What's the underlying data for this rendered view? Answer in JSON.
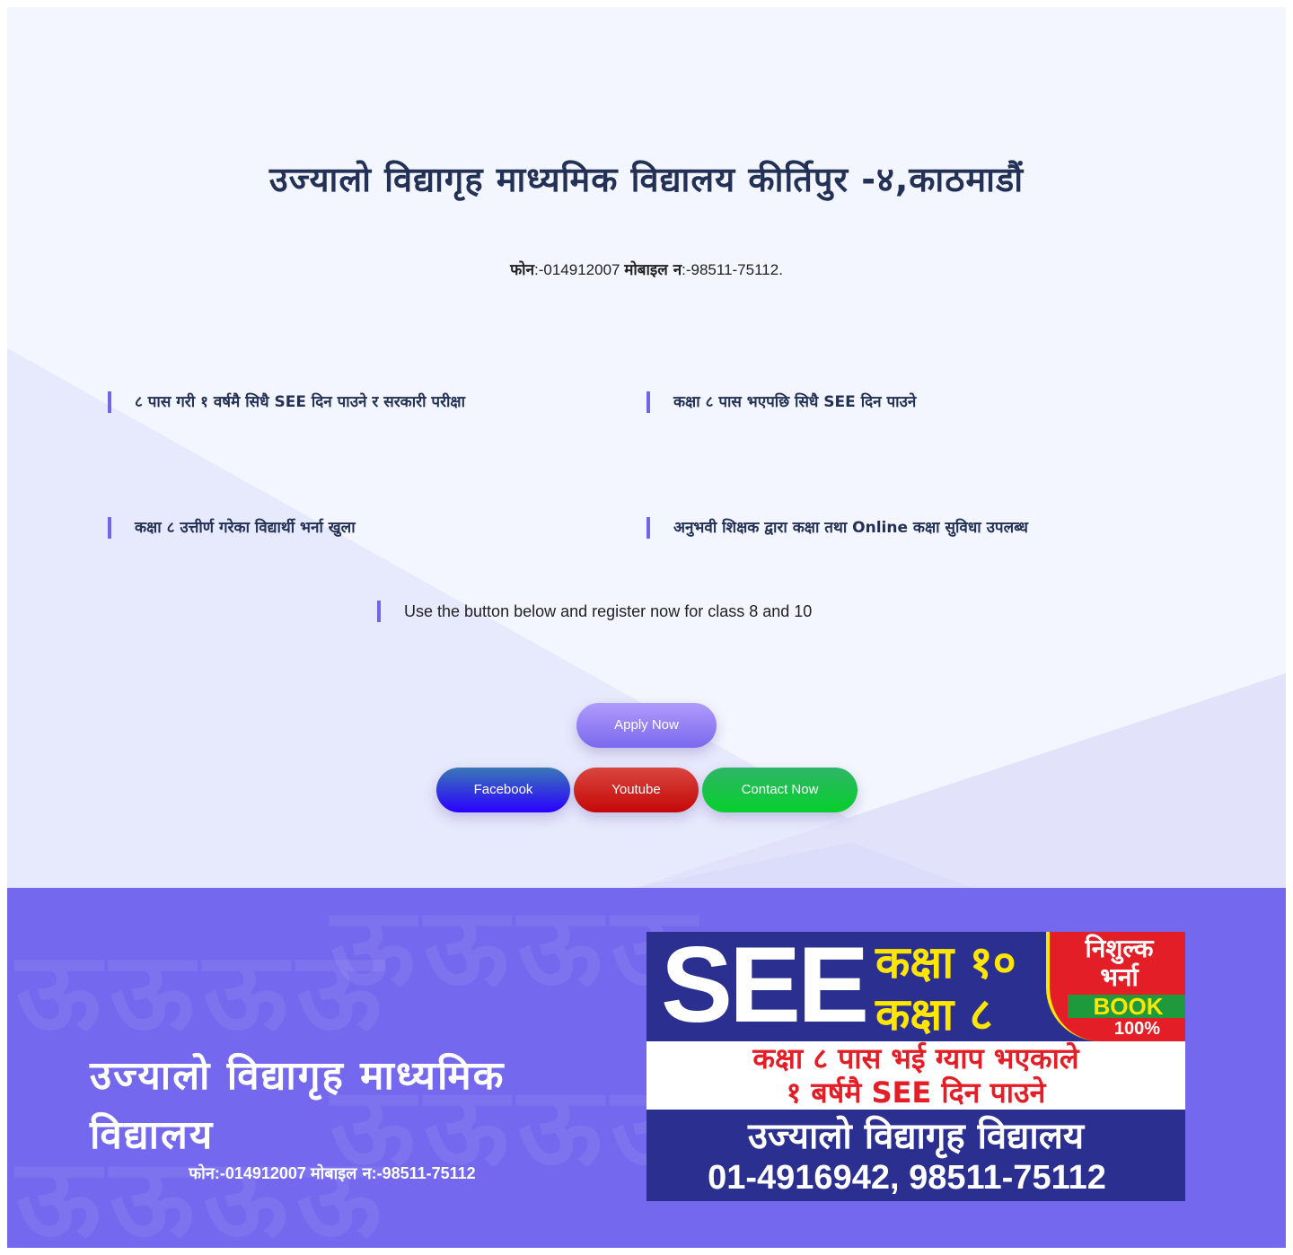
{
  "hero": {
    "title": "उज्यालो विद्यागृह माध्यमिक विद्यालय कीर्तिपुर -४,काठमाडौं",
    "contact_phone_label": "फोन",
    "contact_phone": ":-014912007 ",
    "contact_mobile_label": "मोबाइल न",
    "contact_mobile": ":-98511-75112."
  },
  "features": [
    {
      "text": "८ पास गरी १ वर्षमै सिधै SEE दिन पाउने र सरकारी परीक्षा"
    },
    {
      "text": "कक्षा ८ पास भएपछि सिधै SEE दिन पाउने"
    },
    {
      "text": "कक्षा ८ उत्तीर्ण गरेका विद्यार्थी भर्ना खुला"
    },
    {
      "text": "अनुभवी शिक्षक द्वारा कक्षा तथा Online कक्षा सुविधा उपलब्ध"
    }
  ],
  "note": "Use the button below and register now for class 8 and 10",
  "buttons": {
    "apply": "Apply Now",
    "facebook": "Facebook",
    "youtube": "Youtube",
    "contact": "Contact Now"
  },
  "lower": {
    "title": "उज्यालो विद्यागृह माध्यमिक विद्यालय",
    "contact_phone_label": "फोन",
    "contact_phone": ":-014912007 ",
    "contact_mobile_label": "मोबाइल न",
    "contact_mobile": ":-98511-75112"
  },
  "banner": {
    "see": "SEE",
    "class10": "कक्षा १०",
    "class8": "कक्षा ८",
    "free": "निशुल्क",
    "admission": "भर्ना",
    "book": "BOOK",
    "percent": "100%",
    "line1": "कक्षा ८ पास भई ग्याप भएकाले",
    "line2": "१ बर्षमै SEE दिन पाउने",
    "school": "उज्यालो विद्यागृह विद्यालय",
    "phones": "01-4916942, 98511-75112"
  },
  "colors": {
    "accent": "#7469ee",
    "heading": "#233156",
    "facebook": "#2a00ff",
    "youtube": "#c40808",
    "contact": "#06cf2b"
  }
}
